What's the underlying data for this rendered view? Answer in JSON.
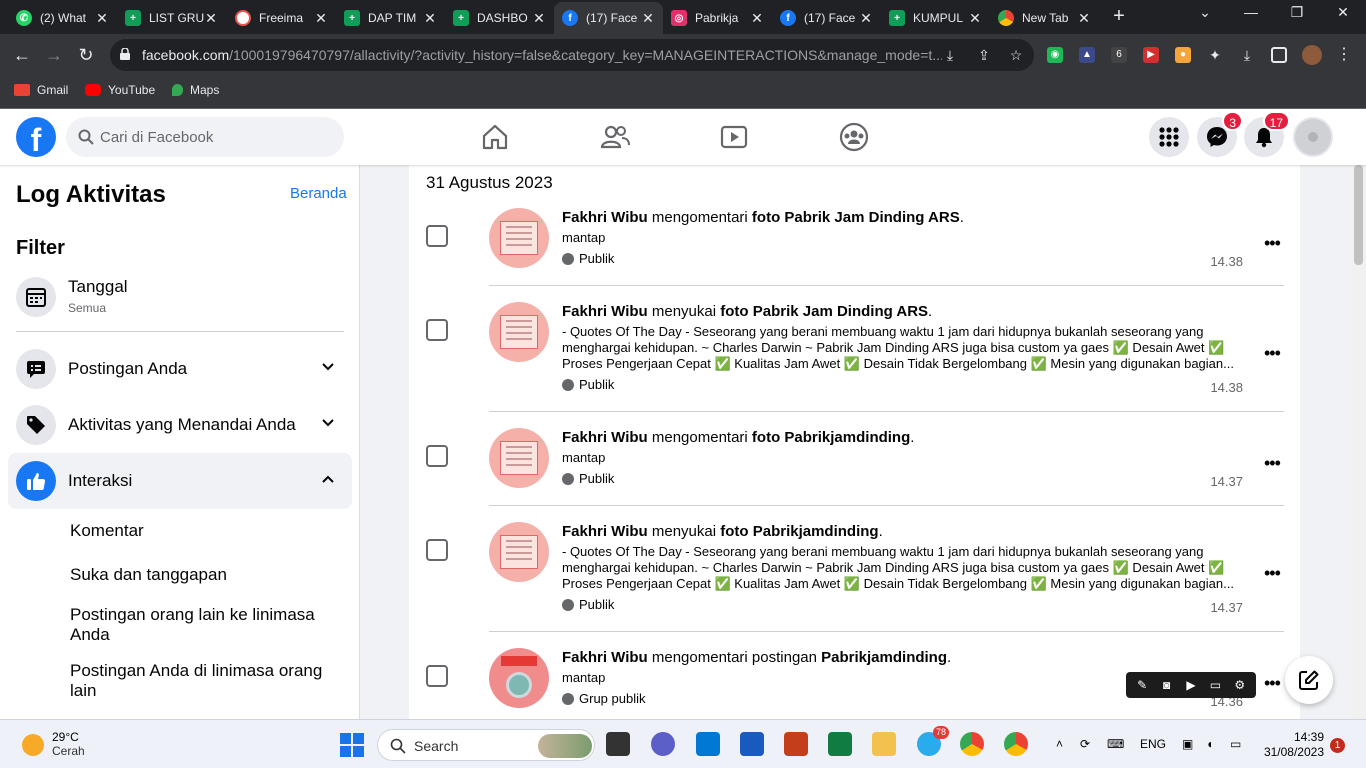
{
  "browser": {
    "tabs": [
      {
        "title": "(2) What",
        "fav": "whatsapp-icon",
        "color": "#25d366"
      },
      {
        "title": "LIST GRU",
        "fav": "sheets-icon",
        "color": "#0f9d58"
      },
      {
        "title": "Freeima",
        "fav": "freeimage-icon",
        "color": "#ef5350"
      },
      {
        "title": "DAP TIM",
        "fav": "sheets-icon",
        "color": "#0f9d58"
      },
      {
        "title": "DASHBO",
        "fav": "sheets-icon",
        "color": "#0f9d58"
      },
      {
        "title": "(17) Face",
        "fav": "facebook-icon",
        "color": "#1877f2"
      },
      {
        "title": "Pabrikja",
        "fav": "instagram-icon",
        "color": "#e1306c"
      },
      {
        "title": "(17) Face",
        "fav": "facebook-icon",
        "color": "#1877f2"
      },
      {
        "title": "KUMPUL",
        "fav": "sheets-icon",
        "color": "#0f9d58"
      },
      {
        "title": "New Tab",
        "fav": "chrome-icon",
        "color": "#9aa0a6"
      }
    ],
    "url_host": "facebook.com",
    "url_path": "/100019796470797/allactivity/?activity_history=false&category_key=MANAGEINTERACTIONS&manage_mode=t...",
    "bookmarks": [
      {
        "label": "Gmail",
        "icon": "gmail-icon",
        "color": "#ea4335"
      },
      {
        "label": "YouTube",
        "icon": "youtube-icon",
        "color": "#ff0000"
      },
      {
        "label": "Maps",
        "icon": "maps-icon",
        "color": "#34a853"
      }
    ]
  },
  "facebook": {
    "logo": "f",
    "search_placeholder": "Cari di Facebook",
    "messenger_badge": "3",
    "notifications_badge": "17"
  },
  "sidebar": {
    "title": "Log Aktivitas",
    "home_link": "Beranda",
    "filter_title": "Filter",
    "date_filter": {
      "label": "Tanggal",
      "value": "Semua"
    },
    "sections": [
      {
        "label": "Postingan Anda"
      },
      {
        "label": "Aktivitas yang Menandai Anda"
      },
      {
        "label": "Interaksi"
      }
    ],
    "interaction_items": [
      "Komentar",
      "Suka dan tanggapan",
      "Postingan orang lain ke linimasa Anda",
      "Postingan Anda di linimasa orang lain"
    ]
  },
  "activity": {
    "date": "31 Agustus 2023",
    "entries": [
      {
        "actor": "Fakhri Wibu",
        "verb": " mengomentari ",
        "object": "foto Pabrik Jam Dinding ARS",
        "end": ".",
        "sub": "mantap",
        "privacy": "Publik",
        "time": "14.38"
      },
      {
        "actor": "Fakhri Wibu",
        "verb": " menyukai ",
        "object": "foto Pabrik Jam Dinding ARS",
        "end": ".",
        "sub": "- Quotes Of The Day - Seseorang yang berani membuang waktu 1 jam dari hidupnya bukanlah seseorang yang menghargai kehidupan. ~ Charles Darwin ~ Pabrik Jam Dinding ARS juga bisa custom ya gaes ✅ Desain Awet ✅ Proses Pengerjaan Cepat ✅ Kualitas Jam Awet ✅ Desain Tidak Bergelombang ✅ Mesin yang digunakan bagian...",
        "privacy": "Publik",
        "time": "14.38"
      },
      {
        "actor": "Fakhri Wibu",
        "verb": " mengomentari ",
        "object": "foto Pabrikjamdinding",
        "end": ".",
        "sub": "mantap",
        "privacy": "Publik",
        "time": "14.37"
      },
      {
        "actor": "Fakhri Wibu",
        "verb": " menyukai ",
        "object": "foto Pabrikjamdinding",
        "end": ".",
        "sub": "- Quotes Of The Day - Seseorang yang berani membuang waktu 1 jam dari hidupnya bukanlah seseorang yang menghargai kehidupan. ~ Charles Darwin ~ Pabrik Jam Dinding ARS juga bisa custom ya gaes ✅ Desain Awet ✅ Proses Pengerjaan Cepat ✅ Kualitas Jam Awet ✅ Desain Tidak Bergelombang ✅ Mesin yang digunakan bagian...",
        "privacy": "Publik",
        "time": "14.37"
      },
      {
        "actor": "Fakhri Wibu",
        "verb": " mengomentari ",
        "object": "postingan ",
        "object2": "Pabrikjamdinding",
        "end": ".",
        "sub": "mantap",
        "privacy": "Grup publik",
        "time": "14.36"
      }
    ]
  },
  "taskbar": {
    "weather_temp": "29°C",
    "weather_desc": "Cerah",
    "search_label": "Search",
    "telegram_badge": "78",
    "lang": "ENG",
    "time": "14:39",
    "date": "31/08/2023",
    "notif_count": "1"
  }
}
